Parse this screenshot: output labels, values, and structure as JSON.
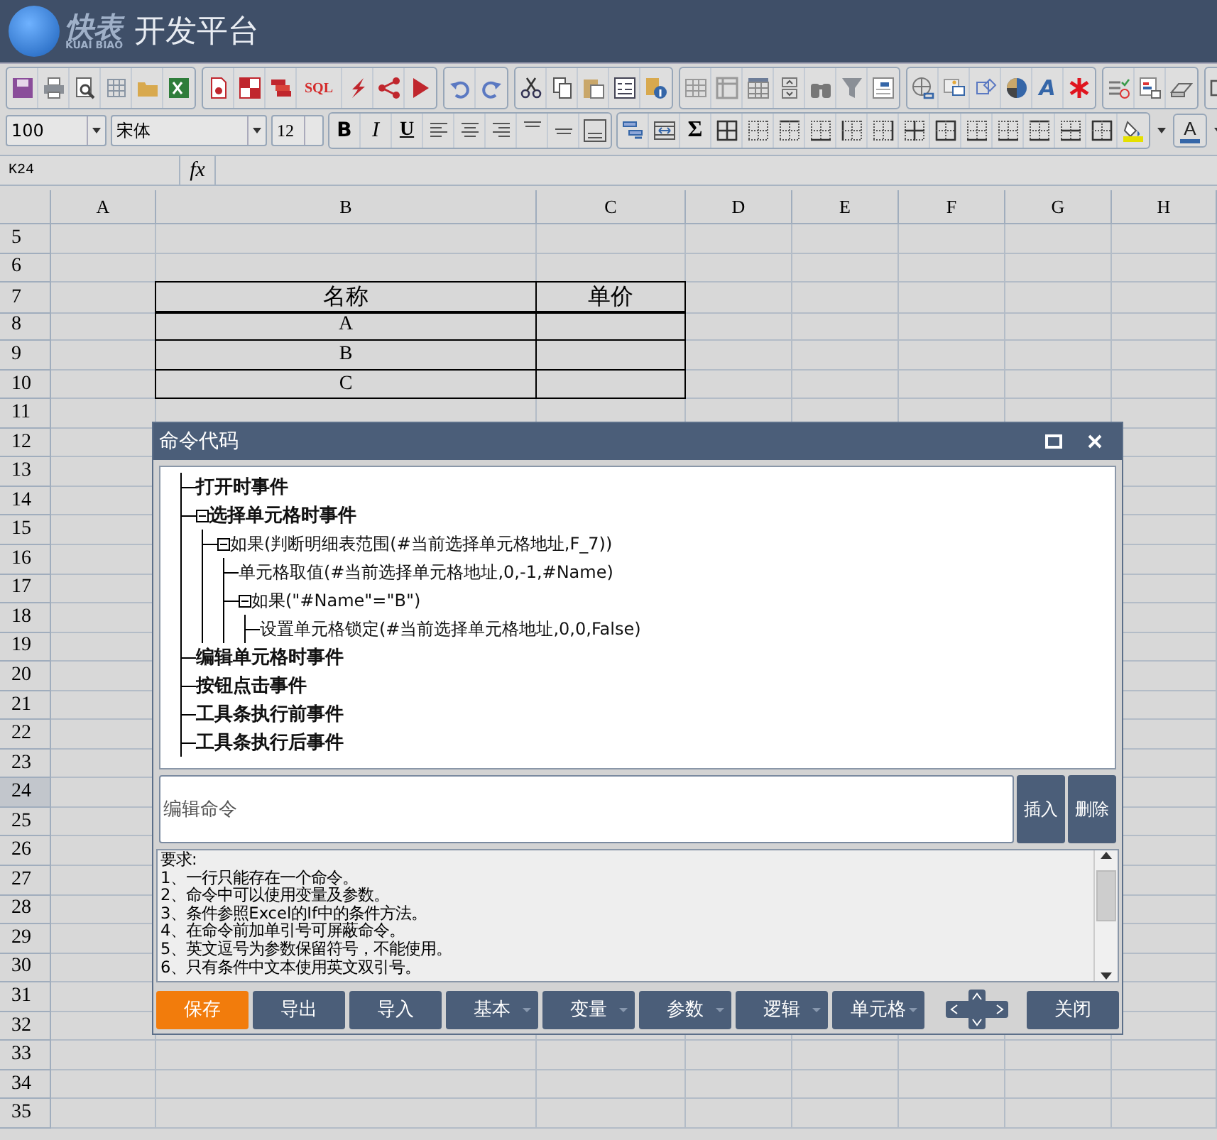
{
  "app": {
    "logo_text": "快表",
    "logo_subtext": "KUAI BIAO",
    "title": "开发平台"
  },
  "toolbar": {
    "sql_label": "SQL",
    "text_style_label": "A"
  },
  "format_bar": {
    "zoom": "100",
    "font": "宋体",
    "font_size": "12",
    "bold_label": "B",
    "italic_label": "I",
    "underline_label": "U",
    "sum_label": "Σ",
    "font_color_label": "A"
  },
  "formula_bar": {
    "cell_ref": "K24",
    "fx_label": "fx"
  },
  "sheet": {
    "columns": [
      "A",
      "B",
      "C",
      "D",
      "E",
      "F",
      "G",
      "H"
    ],
    "rows": [
      {
        "number": "5",
        "selected": false
      },
      {
        "number": "6",
        "selected": false
      },
      {
        "number": "7",
        "selected": false
      },
      {
        "number": "8",
        "selected": false
      },
      {
        "number": "9",
        "selected": false
      },
      {
        "number": "10",
        "selected": false
      },
      {
        "number": "11",
        "selected": false
      },
      {
        "number": "12",
        "selected": false
      },
      {
        "number": "13",
        "selected": false
      },
      {
        "number": "14",
        "selected": false
      },
      {
        "number": "15",
        "selected": false
      },
      {
        "number": "16",
        "selected": false
      },
      {
        "number": "17",
        "selected": false
      },
      {
        "number": "18",
        "selected": false
      },
      {
        "number": "19",
        "selected": false
      },
      {
        "number": "20",
        "selected": false
      },
      {
        "number": "21",
        "selected": false
      },
      {
        "number": "22",
        "selected": false
      },
      {
        "number": "23",
        "selected": false
      },
      {
        "number": "24",
        "selected": true
      },
      {
        "number": "25",
        "selected": false
      },
      {
        "number": "26",
        "selected": false
      },
      {
        "number": "27",
        "selected": false
      },
      {
        "number": "28",
        "selected": false
      },
      {
        "number": "29",
        "selected": false
      },
      {
        "number": "30",
        "selected": false
      },
      {
        "number": "31",
        "selected": false
      },
      {
        "number": "32",
        "selected": false
      },
      {
        "number": "33",
        "selected": false
      },
      {
        "number": "34",
        "selected": false
      },
      {
        "number": "35",
        "selected": false
      }
    ],
    "table": {
      "header": [
        "名称",
        "单价"
      ],
      "rows": [
        [
          "A"
        ],
        [
          "B"
        ],
        [
          "C"
        ]
      ]
    }
  },
  "dialog": {
    "title": "命令代码",
    "tree": [
      {
        "label": "打开时事件"
      },
      {
        "label": "选择单元格时事件",
        "expanded": true,
        "children": [
          {
            "label": "如果(判断明细表范围(#当前选择单元格地址,F_7))",
            "expanded": true,
            "children": [
              {
                "label": "单元格取值(#当前选择单元格地址,0,-1,#Name)"
              },
              {
                "label": "如果(\"#Name\"=\"B\")",
                "expanded": true,
                "children": [
                  {
                    "label": "设置单元格锁定(#当前选择单元格地址,0,0,False)"
                  }
                ]
              }
            ]
          }
        ]
      },
      {
        "label": "编辑单元格时事件"
      },
      {
        "label": "按钮点击事件"
      },
      {
        "label": "工具条执行前事件"
      },
      {
        "label": "工具条执行后事件"
      }
    ],
    "command": {
      "placeholder": "编辑命令"
    },
    "insert_label": "插入",
    "delete_label": "删除",
    "help": [
      "要求:",
      "1、一行只能存在一个命令。",
      "2、命令中可以使用变量及参数。",
      "3、条件参照Excel的If中的条件方法。",
      "4、在命令前加单引号可屏蔽命令。",
      "5、英文逗号为参数保留符号，不能使用。",
      "6、只有条件中文本使用英文双引号。"
    ],
    "buttons": [
      {
        "label": "保存",
        "kind": "primary"
      },
      {
        "label": "导出",
        "kind": "plain"
      },
      {
        "label": "导入",
        "kind": "plain"
      },
      {
        "label": "基本",
        "kind": "dropdown"
      },
      {
        "label": "变量",
        "kind": "dropdown"
      },
      {
        "label": "参数",
        "kind": "dropdown"
      },
      {
        "label": "逻辑",
        "kind": "dropdown"
      },
      {
        "label": "单元格",
        "kind": "dropdown"
      }
    ],
    "close_label": "关闭"
  }
}
